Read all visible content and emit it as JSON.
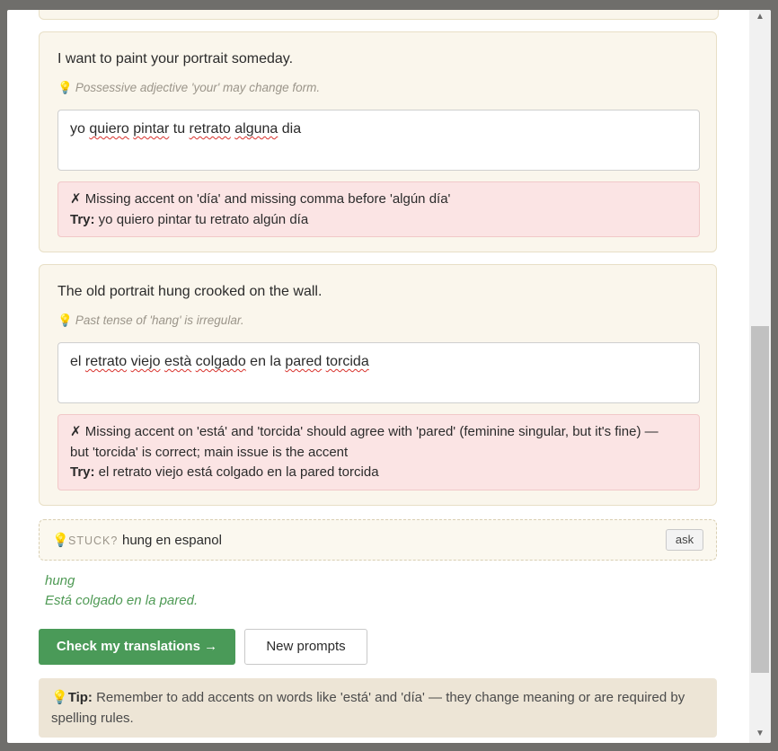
{
  "cards": [
    {
      "prompt": "I want to paint your portrait someday.",
      "hint": "Possessive adjective 'your' may change form.",
      "answer_parts": [
        {
          "t": "yo ",
          "sq": false
        },
        {
          "t": "quiero",
          "sq": true
        },
        {
          "t": " ",
          "sq": false
        },
        {
          "t": "pintar",
          "sq": true
        },
        {
          "t": " tu ",
          "sq": false
        },
        {
          "t": "retrato",
          "sq": true
        },
        {
          "t": " ",
          "sq": false
        },
        {
          "t": "alguna",
          "sq": true
        },
        {
          "t": " dia",
          "sq": false
        }
      ],
      "feedback_line1": "✗ Missing accent on 'día' and missing comma before 'algún día'",
      "feedback_line2": "",
      "try_label": "Try:",
      "try_text": " yo quiero pintar tu retrato algún día"
    },
    {
      "prompt": "The old portrait hung crooked on the wall.",
      "hint": "Past tense of 'hang' is irregular.",
      "answer_parts": [
        {
          "t": "el ",
          "sq": false
        },
        {
          "t": "retrato",
          "sq": true
        },
        {
          "t": " ",
          "sq": false
        },
        {
          "t": "viejo",
          "sq": true
        },
        {
          "t": " ",
          "sq": false
        },
        {
          "t": "està",
          "sq": true
        },
        {
          "t": " ",
          "sq": false
        },
        {
          "t": "colgado",
          "sq": true
        },
        {
          "t": " en la ",
          "sq": false
        },
        {
          "t": "pared",
          "sq": true
        },
        {
          "t": " ",
          "sq": false
        },
        {
          "t": "torcida",
          "sq": true
        }
      ],
      "feedback_line1": "✗ Missing accent on 'está' and 'torcida' should agree with 'pared' (feminine singular, but it's fine) —",
      "feedback_line2": "but 'torcida' is correct; main issue is the accent",
      "try_label": "Try:",
      "try_text": " el retrato viejo está colgado en la pared torcida"
    }
  ],
  "stuck": {
    "label": "STUCK?",
    "query": "hung en espanol",
    "ask_label": "ask",
    "answer_word": "hung",
    "answer_example": "Está colgado en la pared."
  },
  "buttons": {
    "check": "Check my translations →",
    "new_prompts": "New prompts"
  },
  "tip": {
    "label": "Tip:",
    "text": " Remember to add accents on words like 'está' and 'día' — they change meaning or are required by spelling rules."
  },
  "icons": {
    "hint": "lightbulb-icon",
    "scroll_up": "scroll-up-arrow-icon",
    "scroll_down": "scroll-down-arrow-icon"
  },
  "colors": {
    "card_bg": "#faf6ec",
    "feedback_bg": "#fbe4e4",
    "primary": "#4a9a58",
    "answer_green": "#4f9a55",
    "tip_bg": "#ede5d6"
  }
}
